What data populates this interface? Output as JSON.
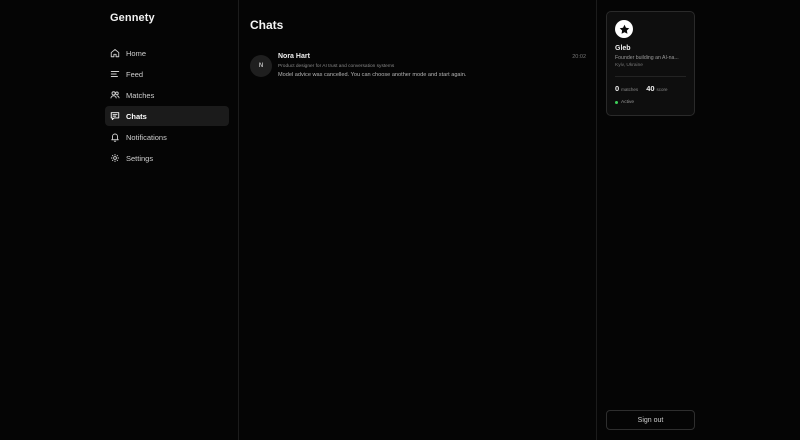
{
  "app": {
    "brand": "Gennety"
  },
  "sidebar": {
    "items": [
      {
        "label": "Home",
        "icon": "home-icon",
        "active": false
      },
      {
        "label": "Feed",
        "icon": "feed-icon",
        "active": false
      },
      {
        "label": "Matches",
        "icon": "users-icon",
        "active": false
      },
      {
        "label": "Chats",
        "icon": "chat-icon",
        "active": true
      },
      {
        "label": "Notifications",
        "icon": "bell-icon",
        "active": false
      },
      {
        "label": "Settings",
        "icon": "gear-icon",
        "active": false
      }
    ]
  },
  "main": {
    "title": "Chats",
    "chats": [
      {
        "avatar_initial": "N",
        "name": "Nora Hart",
        "subtitle": "Product designer for AI trust and conversation systems",
        "last_message": "Model advice was cancelled. You can choose another mode and start again.",
        "time": "20:02"
      }
    ]
  },
  "profile": {
    "badge_icon": "star-icon",
    "name": "Gleb",
    "bio": "Founder building an AI-na...",
    "location": "Kyiv, Ukraine",
    "matches_count": "0",
    "matches_label": "matches",
    "score_count": "40",
    "score_label": "score",
    "status": "Active",
    "status_color": "#3ecf5a"
  },
  "actions": {
    "signout_label": "Sign out"
  },
  "colors": {
    "background": "#050505",
    "active_nav": "#1b1b1b",
    "card": "#0e0e0e"
  }
}
